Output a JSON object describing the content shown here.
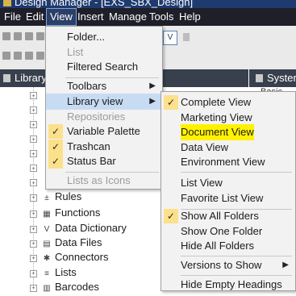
{
  "window": {
    "title": "Design Manager - [EXS_SBX_Design]"
  },
  "menubar": [
    "File",
    "Edit",
    "View",
    "Insert",
    "Manage",
    "Tools",
    "Help"
  ],
  "toolbar": {
    "view_button_label": "V"
  },
  "panels": {
    "library_title": "Library",
    "system_title": "System",
    "system_first_row": "Basic"
  },
  "tree_items": [
    {
      "label": "Rules",
      "icon": "±"
    },
    {
      "label": "Functions",
      "icon": "▦"
    },
    {
      "label": "Data Dictionary",
      "icon": "V"
    },
    {
      "label": "Data Files",
      "icon": "▤"
    },
    {
      "label": "Connectors",
      "icon": "✱"
    },
    {
      "label": "Lists",
      "icon": "≡"
    },
    {
      "label": "Barcodes",
      "icon": "▥"
    }
  ],
  "view_menu": [
    {
      "label": "Folder...",
      "state": "normal"
    },
    {
      "label": "List",
      "state": "disabled"
    },
    {
      "label": "Filtered Search",
      "state": "normal"
    },
    {
      "label": "Toolbars",
      "state": "normal",
      "submenu": true
    },
    {
      "label": "Library view",
      "state": "highlighted",
      "submenu": true
    },
    {
      "label": "Repositories",
      "state": "disabled"
    },
    {
      "label": "Variable Palette",
      "state": "checked"
    },
    {
      "label": "Trashcan",
      "state": "checked"
    },
    {
      "label": "Status Bar",
      "state": "checked"
    },
    {
      "label": "Lists as Icons",
      "state": "disabled"
    }
  ],
  "library_view_menu": [
    {
      "label": "Complete View",
      "checked": true
    },
    {
      "label": "Marketing View"
    },
    {
      "label": "Document View",
      "marker": "yellow-highlight"
    },
    {
      "label": "Data View"
    },
    {
      "label": "Environment View"
    },
    {
      "label": "List View"
    },
    {
      "label": "Favorite List View"
    },
    {
      "label": "Show All Folders",
      "checked": true
    },
    {
      "label": "Show One Folder"
    },
    {
      "label": "Hide All Folders"
    },
    {
      "label": "Versions to Show",
      "submenu": true
    },
    {
      "label": "Hide Empty Headings"
    }
  ],
  "icons": {
    "check": "✓",
    "submenu_arrow": "▶",
    "expand": "+"
  },
  "colors": {
    "highlight": "#c7dcf3",
    "check_bg": "#fde08a",
    "marker": "#fff200",
    "menubar": "#1f1f2a",
    "panel_header": "#38404d"
  }
}
